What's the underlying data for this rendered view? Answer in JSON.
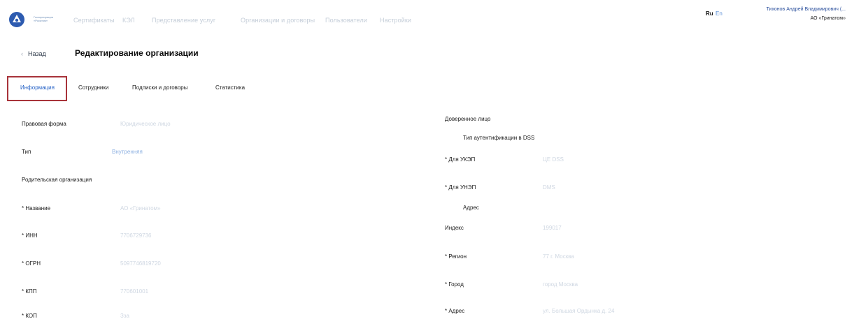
{
  "header": {
    "logo_text": "Госкорпорация «Росатом»",
    "nav": [
      "Сертификаты",
      "КЭЛ",
      "Представление услуг",
      "Организации и договоры",
      "Пользователи",
      "Настройки"
    ],
    "lang": {
      "ru": "Ru",
      "en": "En"
    },
    "user": {
      "name": "Тихонов Андрей Владимирович (...",
      "org": "АО «Гринатом»"
    }
  },
  "colors": {
    "accent": "#2461c6",
    "highlight_border": "#a8333a",
    "muted": "#cfd7e2"
  },
  "page": {
    "back_icon": "chevron-left-icon",
    "back_label": "Назад",
    "title": "Редактирование организации"
  },
  "tabs": [
    "Информация",
    "Сотрудники",
    "Подписки и договоры",
    "Статистика"
  ],
  "left_form": [
    {
      "label": "Правовая форма",
      "value": "Юридическое лицо"
    },
    {
      "label": "Тип",
      "value": "Внутренняя"
    },
    {
      "label": "Родительская организация",
      "value": ""
    },
    {
      "label": "* Название",
      "value": "АО «Гринатом»"
    },
    {
      "label": "* ИНН",
      "value": "7706729736"
    },
    {
      "label": "* ОГРН",
      "value": "5097746819720"
    },
    {
      "label": "* КПП",
      "value": "770601001"
    },
    {
      "label": "* КОП",
      "value": "Зза"
    }
  ],
  "right_form": {
    "trusted_label": "Доверенное лицо",
    "auth_type_heading": "Тип аутентификации в DSS",
    "ukep": {
      "label": "* Для УКЭП",
      "value": "ЦЕ DSS"
    },
    "unep": {
      "label": "* Для УНЭП",
      "value": "DMS"
    },
    "address_heading": "Адрес",
    "index": {
      "label": "Индекс",
      "value": "199017"
    },
    "region": {
      "label": "* Регион",
      "value": "77 г. Москва"
    },
    "city": {
      "label": "* Город",
      "value": "город Москва"
    },
    "address": {
      "label": "* Адрес",
      "value": "ул. Большая Ордынка д. 24"
    }
  }
}
